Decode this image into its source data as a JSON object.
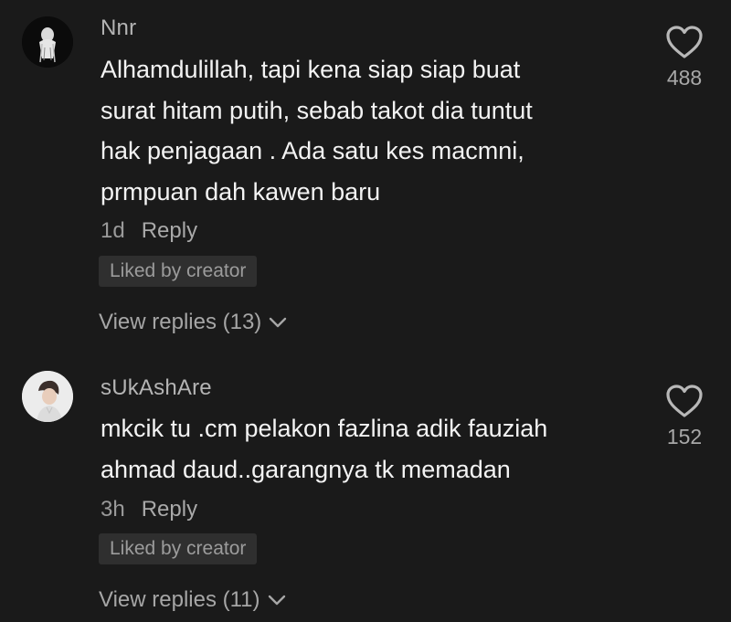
{
  "comments": [
    {
      "username": "Nnr",
      "text": "Alhamdulillah, tapi kena siap siap buat\nsurat hitam putih, sebab takot dia tuntut\nhak penjagaan . Ada satu kes macmni,\nprmpuan dah kawen baru",
      "time": "1d",
      "reply_label": "Reply",
      "liked_badge": "Liked by creator",
      "view_replies": "View replies (13)",
      "likes": "488",
      "avatar_icon": "dark-figure-avatar-icon"
    },
    {
      "username": "sUkAshAre",
      "text": "mkcik tu .cm pelakon fazlina adik fauziah\nahmad daud..garangnya tk memadan",
      "time": "3h",
      "reply_label": "Reply",
      "liked_badge": "Liked by creator",
      "view_replies": "View replies (11)",
      "likes": "152",
      "avatar_icon": "person-photo-avatar-icon"
    }
  ],
  "colors": {
    "background": "#1a1a1a",
    "username": "#b4b4b4",
    "body_text": "#f3f3f3",
    "meta": "#9a9a9a",
    "badge_bg": "#2f2f2f"
  }
}
